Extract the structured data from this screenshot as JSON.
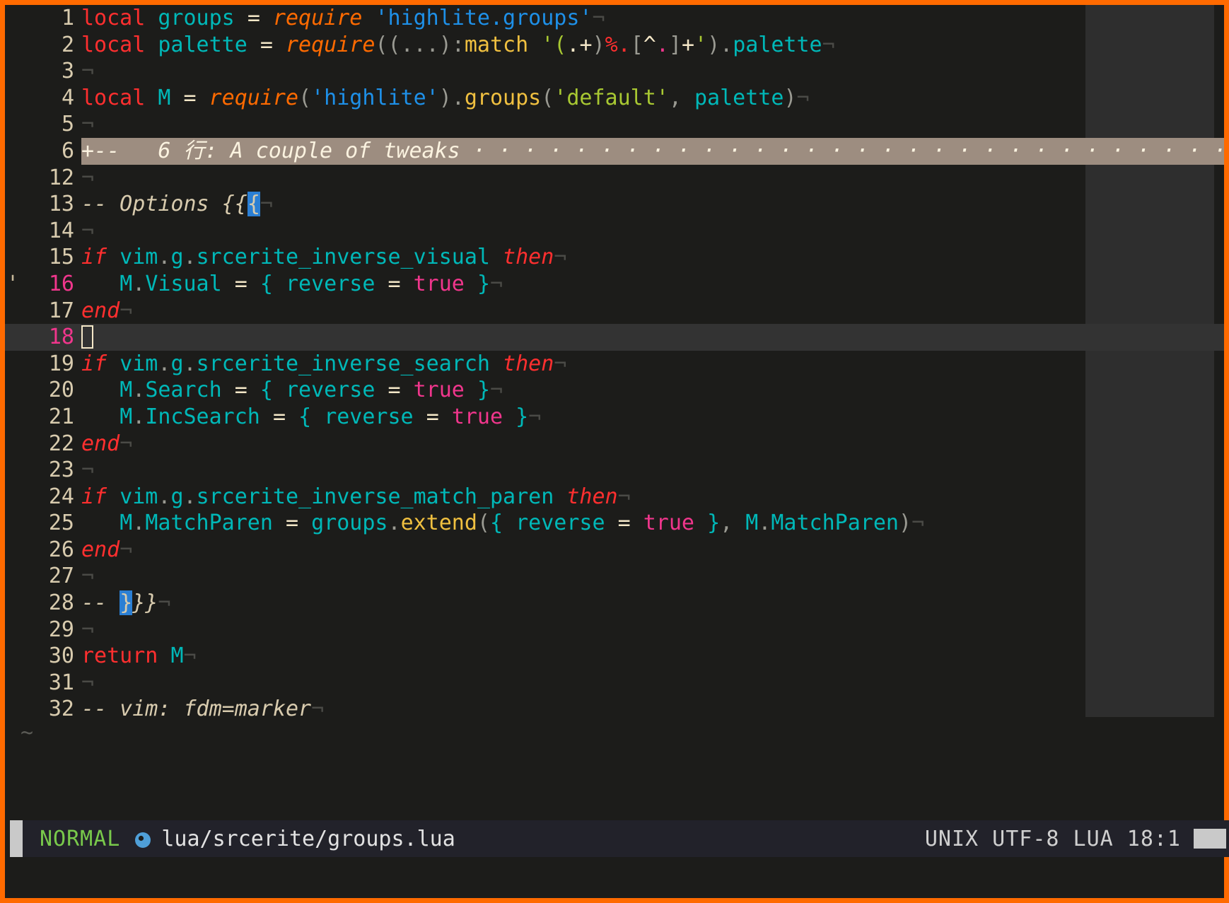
{
  "window": {
    "border_color": "#ff6a00",
    "background": "#1c1c1a"
  },
  "editor": {
    "filetype": "lua",
    "eol_marker": "¬",
    "fold_fill_char": "·",
    "lines": [
      {
        "num": "1",
        "tokens": [
          {
            "t": "local",
            "c": "kw"
          },
          {
            "t": " ",
            "c": "plain"
          },
          {
            "t": "groups",
            "c": "id"
          },
          {
            "t": " ",
            "c": "plain"
          },
          {
            "t": "=",
            "c": "op"
          },
          {
            "t": " ",
            "c": "plain"
          },
          {
            "t": "require",
            "c": "fn"
          },
          {
            "t": " ",
            "c": "plain"
          },
          {
            "t": "'highlite.groups'",
            "c": "str"
          },
          {
            "t": "¬",
            "c": "eol"
          }
        ]
      },
      {
        "num": "2",
        "tokens": [
          {
            "t": "local",
            "c": "kw"
          },
          {
            "t": " ",
            "c": "plain"
          },
          {
            "t": "palette",
            "c": "id"
          },
          {
            "t": " ",
            "c": "plain"
          },
          {
            "t": "=",
            "c": "op"
          },
          {
            "t": " ",
            "c": "plain"
          },
          {
            "t": "require",
            "c": "fn"
          },
          {
            "t": "((",
            "c": "punc"
          },
          {
            "t": "...",
            "c": "punc"
          },
          {
            "t": ")",
            "c": "punc"
          },
          {
            "t": ":",
            "c": "punc"
          },
          {
            "t": "match",
            "c": "meth"
          },
          {
            "t": " ",
            "c": "plain"
          },
          {
            "t": "'(",
            "c": "str2"
          },
          {
            "t": ".",
            "c": "op"
          },
          {
            "t": "+",
            "c": "op"
          },
          {
            "t": ")",
            "c": "punc"
          },
          {
            "t": "%.",
            "c": "spec"
          },
          {
            "t": "[",
            "c": "punc"
          },
          {
            "t": "^",
            "c": "op"
          },
          {
            "t": ".",
            "c": "spec2"
          },
          {
            "t": "]",
            "c": "punc"
          },
          {
            "t": "+",
            "c": "op"
          },
          {
            "t": "'",
            "c": "spec3"
          },
          {
            "t": ")",
            "c": "punc"
          },
          {
            "t": ".",
            "c": "punc"
          },
          {
            "t": "palette",
            "c": "id"
          },
          {
            "t": "¬",
            "c": "eol"
          }
        ]
      },
      {
        "num": "3",
        "tokens": [
          {
            "t": "¬",
            "c": "eol"
          }
        ]
      },
      {
        "num": "4",
        "tokens": [
          {
            "t": "local",
            "c": "kw"
          },
          {
            "t": " ",
            "c": "plain"
          },
          {
            "t": "M",
            "c": "id"
          },
          {
            "t": " ",
            "c": "plain"
          },
          {
            "t": "=",
            "c": "op"
          },
          {
            "t": " ",
            "c": "plain"
          },
          {
            "t": "require",
            "c": "fn"
          },
          {
            "t": "(",
            "c": "punc"
          },
          {
            "t": "'highlite'",
            "c": "str"
          },
          {
            "t": ")",
            "c": "punc"
          },
          {
            "t": ".",
            "c": "punc"
          },
          {
            "t": "groups",
            "c": "meth"
          },
          {
            "t": "(",
            "c": "punc"
          },
          {
            "t": "'default'",
            "c": "str2"
          },
          {
            "t": ",",
            "c": "punc"
          },
          {
            "t": " ",
            "c": "plain"
          },
          {
            "t": "palette",
            "c": "id"
          },
          {
            "t": ")",
            "c": "punc"
          },
          {
            "t": "¬",
            "c": "eol"
          }
        ]
      },
      {
        "num": "5",
        "tokens": [
          {
            "t": "¬",
            "c": "eol"
          }
        ]
      },
      {
        "num": "6",
        "fold": true,
        "fold_text": "+--   6 行: A couple of tweaks ",
        "fold_lines": "6"
      },
      {
        "num": "12",
        "tokens": [
          {
            "t": "¬",
            "c": "eol"
          }
        ]
      },
      {
        "num": "13",
        "tokens": [
          {
            "t": "-- Options {{",
            "c": "cmt"
          },
          {
            "t": "{",
            "c": "match"
          },
          {
            "t": "¬",
            "c": "eol"
          }
        ]
      },
      {
        "num": "14",
        "tokens": [
          {
            "t": "¬",
            "c": "eol"
          }
        ]
      },
      {
        "num": "15",
        "tokens": [
          {
            "t": "if",
            "c": "kwi"
          },
          {
            "t": " ",
            "c": "plain"
          },
          {
            "t": "vim",
            "c": "id"
          },
          {
            "t": ".",
            "c": "punc"
          },
          {
            "t": "g",
            "c": "id"
          },
          {
            "t": ".",
            "c": "punc"
          },
          {
            "t": "srcerite_inverse_visual",
            "c": "id"
          },
          {
            "t": " ",
            "c": "plain"
          },
          {
            "t": "then",
            "c": "kwi"
          },
          {
            "t": "¬",
            "c": "eol"
          }
        ]
      },
      {
        "num": "16",
        "mark": "'",
        "marked": true,
        "tokens": [
          {
            "t": "   ",
            "c": "plain"
          },
          {
            "t": "M",
            "c": "id"
          },
          {
            "t": ".",
            "c": "punc"
          },
          {
            "t": "Visual",
            "c": "id"
          },
          {
            "t": " ",
            "c": "plain"
          },
          {
            "t": "=",
            "c": "op"
          },
          {
            "t": " ",
            "c": "plain"
          },
          {
            "t": "{",
            "c": "id"
          },
          {
            "t": " ",
            "c": "plain"
          },
          {
            "t": "reverse",
            "c": "id"
          },
          {
            "t": " ",
            "c": "plain"
          },
          {
            "t": "=",
            "c": "op"
          },
          {
            "t": " ",
            "c": "plain"
          },
          {
            "t": "true",
            "c": "bool"
          },
          {
            "t": " ",
            "c": "plain"
          },
          {
            "t": "}",
            "c": "id"
          },
          {
            "t": "¬",
            "c": "eol"
          }
        ]
      },
      {
        "num": "17",
        "tokens": [
          {
            "t": "end",
            "c": "kwi"
          },
          {
            "t": "¬",
            "c": "eol"
          }
        ]
      },
      {
        "num": "18",
        "cursorline": true,
        "cursor": true,
        "tokens": []
      },
      {
        "num": "19",
        "tokens": [
          {
            "t": "if",
            "c": "kwi"
          },
          {
            "t": " ",
            "c": "plain"
          },
          {
            "t": "vim",
            "c": "id"
          },
          {
            "t": ".",
            "c": "punc"
          },
          {
            "t": "g",
            "c": "id"
          },
          {
            "t": ".",
            "c": "punc"
          },
          {
            "t": "srcerite_inverse_search",
            "c": "id"
          },
          {
            "t": " ",
            "c": "plain"
          },
          {
            "t": "then",
            "c": "kwi"
          },
          {
            "t": "¬",
            "c": "eol"
          }
        ]
      },
      {
        "num": "20",
        "tokens": [
          {
            "t": "   ",
            "c": "plain"
          },
          {
            "t": "M",
            "c": "id"
          },
          {
            "t": ".",
            "c": "punc"
          },
          {
            "t": "Search",
            "c": "id"
          },
          {
            "t": " ",
            "c": "plain"
          },
          {
            "t": "=",
            "c": "op"
          },
          {
            "t": " ",
            "c": "plain"
          },
          {
            "t": "{",
            "c": "id"
          },
          {
            "t": " ",
            "c": "plain"
          },
          {
            "t": "reverse",
            "c": "id"
          },
          {
            "t": " ",
            "c": "plain"
          },
          {
            "t": "=",
            "c": "op"
          },
          {
            "t": " ",
            "c": "plain"
          },
          {
            "t": "true",
            "c": "bool"
          },
          {
            "t": " ",
            "c": "plain"
          },
          {
            "t": "}",
            "c": "id"
          },
          {
            "t": "¬",
            "c": "eol"
          }
        ]
      },
      {
        "num": "21",
        "tokens": [
          {
            "t": "   ",
            "c": "plain"
          },
          {
            "t": "M",
            "c": "id"
          },
          {
            "t": ".",
            "c": "punc"
          },
          {
            "t": "IncSearch",
            "c": "id"
          },
          {
            "t": " ",
            "c": "plain"
          },
          {
            "t": "=",
            "c": "op"
          },
          {
            "t": " ",
            "c": "plain"
          },
          {
            "t": "{",
            "c": "id"
          },
          {
            "t": " ",
            "c": "plain"
          },
          {
            "t": "reverse",
            "c": "id"
          },
          {
            "t": " ",
            "c": "plain"
          },
          {
            "t": "=",
            "c": "op"
          },
          {
            "t": " ",
            "c": "plain"
          },
          {
            "t": "true",
            "c": "bool"
          },
          {
            "t": " ",
            "c": "plain"
          },
          {
            "t": "}",
            "c": "id"
          },
          {
            "t": "¬",
            "c": "eol"
          }
        ]
      },
      {
        "num": "22",
        "tokens": [
          {
            "t": "end",
            "c": "kwi"
          },
          {
            "t": "¬",
            "c": "eol"
          }
        ]
      },
      {
        "num": "23",
        "tokens": [
          {
            "t": "¬",
            "c": "eol"
          }
        ]
      },
      {
        "num": "24",
        "tokens": [
          {
            "t": "if",
            "c": "kwi"
          },
          {
            "t": " ",
            "c": "plain"
          },
          {
            "t": "vim",
            "c": "id"
          },
          {
            "t": ".",
            "c": "punc"
          },
          {
            "t": "g",
            "c": "id"
          },
          {
            "t": ".",
            "c": "punc"
          },
          {
            "t": "srcerite_inverse_match_paren",
            "c": "id"
          },
          {
            "t": " ",
            "c": "plain"
          },
          {
            "t": "then",
            "c": "kwi"
          },
          {
            "t": "¬",
            "c": "eol"
          }
        ]
      },
      {
        "num": "25",
        "tokens": [
          {
            "t": "   ",
            "c": "plain"
          },
          {
            "t": "M",
            "c": "id"
          },
          {
            "t": ".",
            "c": "punc"
          },
          {
            "t": "MatchParen",
            "c": "id"
          },
          {
            "t": " ",
            "c": "plain"
          },
          {
            "t": "=",
            "c": "op"
          },
          {
            "t": " ",
            "c": "plain"
          },
          {
            "t": "groups",
            "c": "id"
          },
          {
            "t": ".",
            "c": "punc"
          },
          {
            "t": "extend",
            "c": "meth"
          },
          {
            "t": "(",
            "c": "punc"
          },
          {
            "t": "{",
            "c": "id"
          },
          {
            "t": " ",
            "c": "plain"
          },
          {
            "t": "reverse",
            "c": "id"
          },
          {
            "t": " ",
            "c": "plain"
          },
          {
            "t": "=",
            "c": "op"
          },
          {
            "t": " ",
            "c": "plain"
          },
          {
            "t": "true",
            "c": "bool"
          },
          {
            "t": " ",
            "c": "plain"
          },
          {
            "t": "}",
            "c": "id"
          },
          {
            "t": ",",
            "c": "punc"
          },
          {
            "t": " ",
            "c": "plain"
          },
          {
            "t": "M",
            "c": "id"
          },
          {
            "t": ".",
            "c": "punc"
          },
          {
            "t": "MatchParen",
            "c": "id"
          },
          {
            "t": ")",
            "c": "punc"
          },
          {
            "t": "¬",
            "c": "eol"
          }
        ]
      },
      {
        "num": "26",
        "tokens": [
          {
            "t": "end",
            "c": "kwi"
          },
          {
            "t": "¬",
            "c": "eol"
          }
        ]
      },
      {
        "num": "27",
        "tokens": [
          {
            "t": "¬",
            "c": "eol"
          }
        ]
      },
      {
        "num": "28",
        "tokens": [
          {
            "t": "-- ",
            "c": "cmt"
          },
          {
            "t": "}",
            "c": "match"
          },
          {
            "t": "}}",
            "c": "cmt"
          },
          {
            "t": "¬",
            "c": "eol"
          }
        ]
      },
      {
        "num": "29",
        "tokens": [
          {
            "t": "¬",
            "c": "eol"
          }
        ]
      },
      {
        "num": "30",
        "tokens": [
          {
            "t": "return",
            "c": "kw"
          },
          {
            "t": " ",
            "c": "plain"
          },
          {
            "t": "M",
            "c": "id"
          },
          {
            "t": "¬",
            "c": "eol"
          }
        ]
      },
      {
        "num": "31",
        "tokens": [
          {
            "t": "¬",
            "c": "eol"
          }
        ]
      },
      {
        "num": "32",
        "tokens": [
          {
            "t": "-- vim: fdm=marker",
            "c": "cmt"
          },
          {
            "t": "¬",
            "c": "eol"
          }
        ]
      }
    ],
    "filler_symbol": "~"
  },
  "statusline": {
    "mode": "NORMAL",
    "file_icon": "lua-moon-icon",
    "filename": "lua/srcerite/groups.lua",
    "fileformat": "UNIX",
    "encoding": "UTF-8",
    "language": "LUA",
    "position": "18:1",
    "right_text": "UNIX UTF-8 LUA 18:1",
    "mode_color": "#79c94b",
    "icon_color": "#4f9fd8"
  }
}
